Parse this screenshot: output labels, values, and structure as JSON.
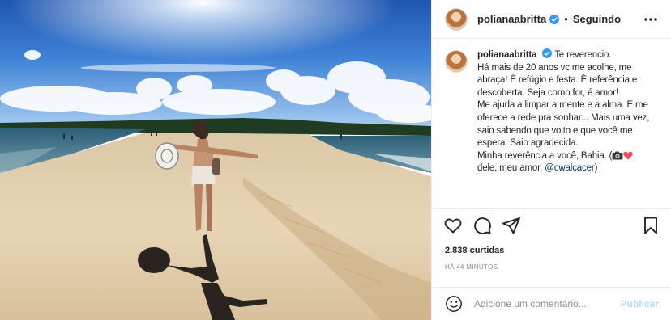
{
  "post": {
    "username": "polianaabritta",
    "follow_state": "Seguindo",
    "separator": "•",
    "caption_lines": [
      "Te reverencio.",
      "Há mais de 20 anos vc me acolhe, me abraça! É refúgio e festa. É referência e descoberta. Seja como for, é amor!",
      "Me ajuda a limpar a mente e a alma. E me oferece a rede pra sonhar... Mais uma vez, saio sabendo que volto e que você me espera. Saio agradecida.",
      "Minha reverência a você, Bahia."
    ],
    "caption_tail": "dele, meu amor,",
    "mention": "@cwalcacer",
    "likes": "2.838 curtidas",
    "timestamp": "HÁ 44 MINUTOS"
  },
  "comment_box": {
    "placeholder": "Adicione um comentário...",
    "publish_label": "Publicar"
  },
  "icons": {
    "verified": "verified-badge-icon",
    "more": "more-options-icon",
    "like": "heart-icon",
    "comment": "comment-icon",
    "share": "send-icon",
    "save": "bookmark-icon",
    "emoji": "smile-icon"
  },
  "colors": {
    "verified": "#3897f0",
    "link": "#00376b",
    "publish_disabled": "#b2dffc",
    "heart_emoji": "#ed4956"
  }
}
